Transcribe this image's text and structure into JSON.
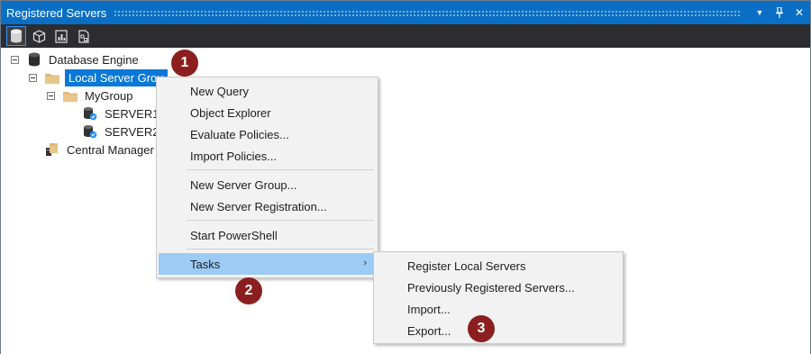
{
  "window": {
    "title": "Registered Servers",
    "dropdown_glyph": "▼",
    "pin_glyph": "📌",
    "close_glyph": "✕"
  },
  "toolbar": {
    "buttons": [
      {
        "icon": "database-engine-icon",
        "active": true
      },
      {
        "icon": "analysis-services-cube-icon",
        "active": false
      },
      {
        "icon": "reporting-services-icon",
        "active": false
      },
      {
        "icon": "integration-services-icon",
        "active": false
      }
    ]
  },
  "tree": {
    "root": {
      "label": "Database Engine",
      "icon": "database-icon"
    },
    "local_group": {
      "label": "Local Server Grou",
      "icon": "folder-icon"
    },
    "my_group": {
      "label": "MyGroup",
      "icon": "folder-icon"
    },
    "server1": {
      "label": "SERVER1",
      "icon": "server-icon"
    },
    "server2": {
      "label": "SERVER2",
      "icon": "server-icon"
    },
    "central": {
      "label": "Central Manager",
      "icon": "central-management-icon"
    }
  },
  "context_menu": {
    "items": [
      {
        "label": "New Query"
      },
      {
        "label": "Object Explorer"
      },
      {
        "label": "Evaluate Policies..."
      },
      {
        "label": "Import Policies..."
      },
      {
        "label": "New Server Group..."
      },
      {
        "label": "New Server Registration..."
      },
      {
        "label": "Start PowerShell"
      },
      {
        "label": "Tasks",
        "submenu_arrow": "›"
      }
    ]
  },
  "tasks_submenu": {
    "items": [
      {
        "label": "Register Local Servers"
      },
      {
        "label": "Previously Registered Servers..."
      },
      {
        "label": "Import..."
      },
      {
        "label": "Export..."
      }
    ]
  },
  "callouts": [
    {
      "number": "1"
    },
    {
      "number": "2"
    },
    {
      "number": "3"
    }
  ],
  "colors": {
    "titlebar": "#0a6fc4",
    "toolbar": "#2d2d30",
    "selection": "#0a78d7",
    "menu_highlight": "#9ccbf5",
    "callout": "#8b1f1f"
  }
}
